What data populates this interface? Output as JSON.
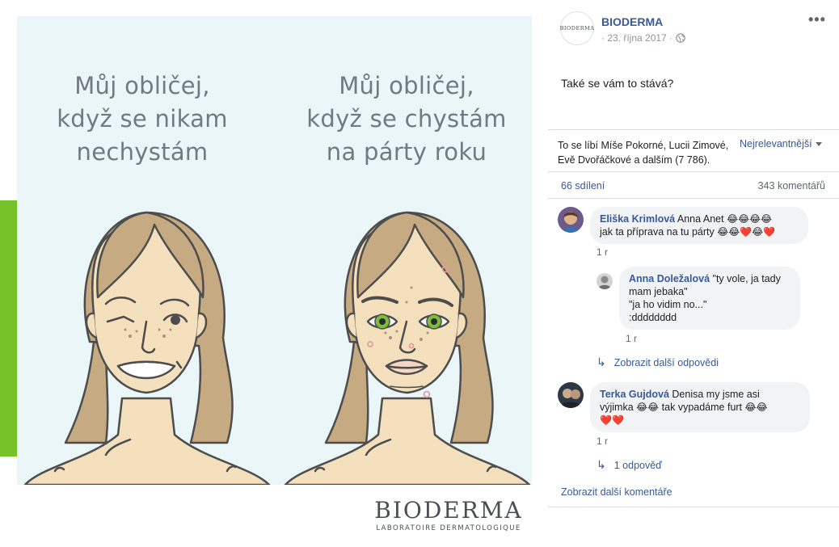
{
  "image": {
    "caption_left": "Můj obličej,\nkdyž se nikam\nnechystám",
    "caption_right": "Můj obličej,\nkdyž se chystám\nna párty roku",
    "logo_name": "BIODERMA",
    "logo_sub": "LABORATOIRE DERMATOLOGIQUE",
    "colors": {
      "background": "#eaf6f8",
      "green_bar": "#76c228",
      "hair": "#c6ab82",
      "skin": "#f5e0bd"
    }
  },
  "post": {
    "page_avatar_text": "BIODERMA",
    "page_name": "BIODERMA",
    "date": "· 23. října 2017 ·",
    "audience_icon": "globe-icon",
    "more_icon": "•••",
    "text": "Také se vám to stává?",
    "likes_text": "To se líbí Míše Pokorné, Lucii Zimové, Evě Dvořáčkové a dalším (7 786).",
    "sort_label": "Nejrelevantnější",
    "shares": "66 sdílení",
    "comments_count": "343 komentářů"
  },
  "comments": [
    {
      "author": "Eliška Krimlová",
      "text_line1": " Anna Anet ",
      "emoji_line1": "😂😂😂😂",
      "text_line2": "jak ta příprava na tu párty ",
      "emoji_line2": "😂😂❤️😂❤️",
      "time": "1 r",
      "reply": {
        "author": "Anna Doležalová",
        "line1": " \"ty vole, ja tady",
        "line2": "mam jebaka\"",
        "line3": "\"ja ho vidim no...\"",
        "line4": ":dddddddd",
        "time": "1 r"
      },
      "more_replies": "Zobrazit další odpovědi"
    },
    {
      "author": "Terka Gujdová",
      "text_line1": " Denisa my jsme asi",
      "text_line2a": "výjimka ",
      "emoji_line2a": "😂😂",
      "text_line2b": " tak vypadáme furt ",
      "emoji_line2b": "😂😂",
      "emoji_line3": "❤️❤️",
      "time": "1 r",
      "replies_link": "1 odpověď"
    }
  ],
  "more_comments": "Zobrazit další komentáře",
  "colors": {
    "link": "#385898",
    "meta": "#90949c",
    "bubble": "#f2f3f5"
  }
}
